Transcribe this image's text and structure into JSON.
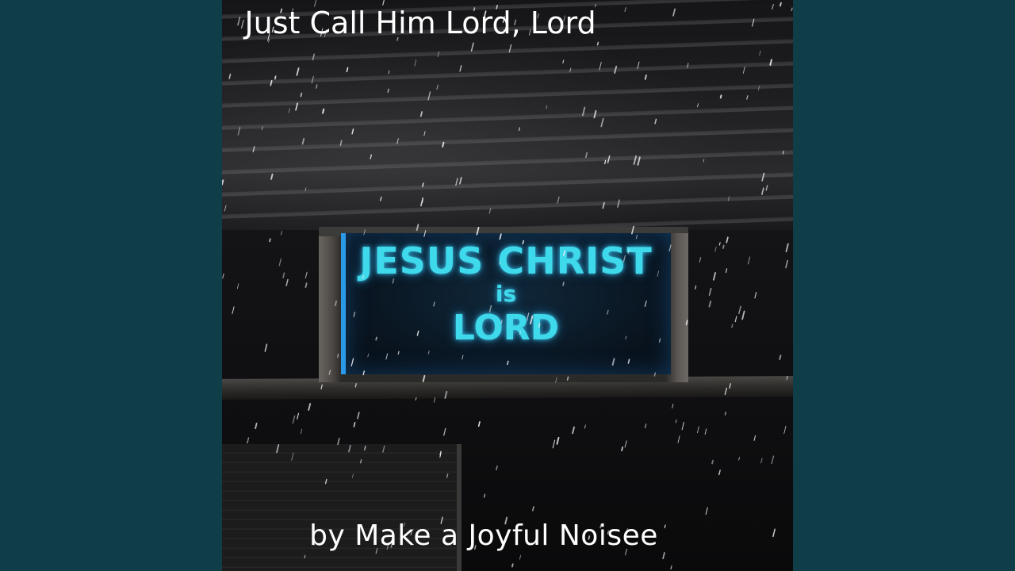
{
  "background_color": "#0f3e48",
  "cover": {
    "sign": {
      "line1": "JESUS CHRIST",
      "line2": "is",
      "line3": "LORD",
      "glow_color": "#3fd9ec"
    }
  },
  "caption": {
    "title": "Just Call Him Lord, Lord",
    "artist": "by Make a Joyful Noisee"
  }
}
